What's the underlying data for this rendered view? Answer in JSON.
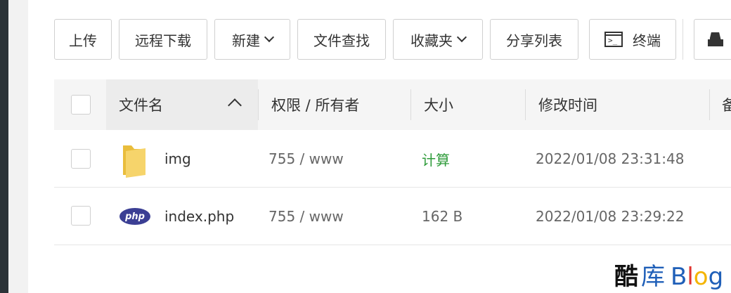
{
  "toolbar": {
    "upload": "上传",
    "remote_download": "远程下载",
    "new": "新建",
    "file_search": "文件查找",
    "favorites": "收藏夹",
    "share_list": "分享列表",
    "terminal": "终端"
  },
  "table": {
    "headers": {
      "name": "文件名",
      "permission": "权限 / 所有者",
      "size": "大小",
      "modified": "修改时间",
      "extra": "备"
    },
    "rows": [
      {
        "name": "img",
        "permission": "755 / www",
        "size": "计算",
        "modified": "2022/01/08 23:31:48",
        "type": "folder"
      },
      {
        "name": "index.php",
        "permission": "755 / www",
        "size": "162 B",
        "modified": "2022/01/08 23:29:22",
        "type": "php"
      }
    ]
  },
  "icons": {
    "php_label": "php"
  },
  "watermark": {
    "part1": "酷",
    "part2": "库",
    "b": "B",
    "l": "l",
    "o": "o",
    "g": "g"
  },
  "colors": {
    "size_calc": "#2e9b3a",
    "php_badge": "#3b3f94",
    "folder": "#f6d46b"
  }
}
